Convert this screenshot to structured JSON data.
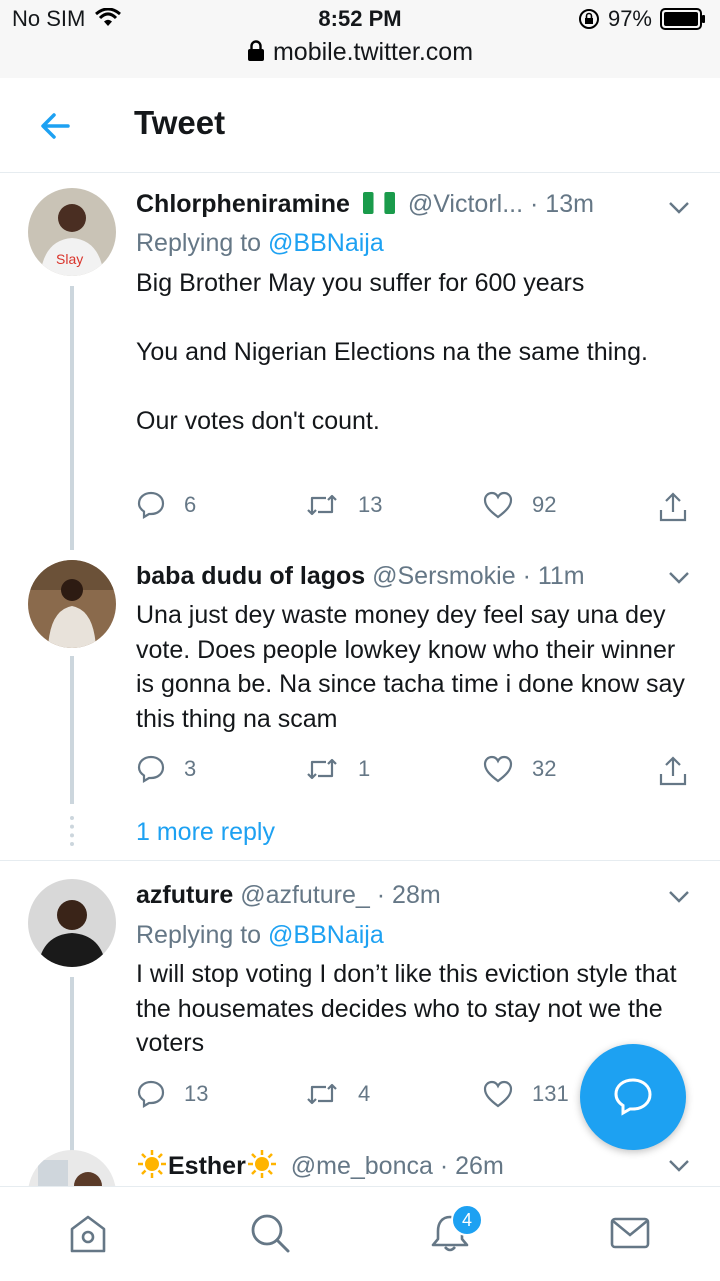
{
  "status_bar": {
    "carrier": "No SIM",
    "time": "8:52 PM",
    "battery": "97%",
    "url": "mobile.twitter.com"
  },
  "header": {
    "title": "Tweet"
  },
  "tweets": [
    {
      "name": "Chlorpheniramine",
      "flag": "nigeria-flag",
      "handle": "@Victorl...",
      "time": "· 13m",
      "replying_prefix": "Replying to",
      "replying_to": "@BBNaija",
      "text": "Big Brother May you suffer for 600 years\n\nYou and Nigerian Elections na the same thing.\n\nOur votes don't count.",
      "replies": "6",
      "retweets": "13",
      "likes": "92"
    },
    {
      "name": "baba dudu of lagos",
      "handle": "@Sersmokie",
      "time": "· 11m",
      "text": "Una just dey waste money dey feel say una dey vote. Does people lowkey know who their winner is gonna be. Na since tacha time i done know say this thing na scam",
      "replies": "3",
      "retweets": "1",
      "likes": "32"
    },
    {
      "name": "azfuture",
      "handle": "@azfuture_",
      "time": "· 28m",
      "replying_prefix": "Replying to",
      "replying_to": "@BBNaija",
      "text": "I will stop voting I don’t like this eviction style that the housemates decides who to stay not we the voters",
      "replies": "13",
      "retweets": "4",
      "likes": "131"
    },
    {
      "name": "Esther",
      "handle": "@me_bonca",
      "time": "· 26m"
    }
  ],
  "more_replies": "1 more reply",
  "tabbar": {
    "notifications_badge": "4",
    "icons": [
      "home-icon",
      "search-icon",
      "notifications-icon",
      "messages-icon"
    ]
  },
  "colors": {
    "accent": "#1da1f2",
    "muted": "#657786",
    "text": "#14171a"
  }
}
